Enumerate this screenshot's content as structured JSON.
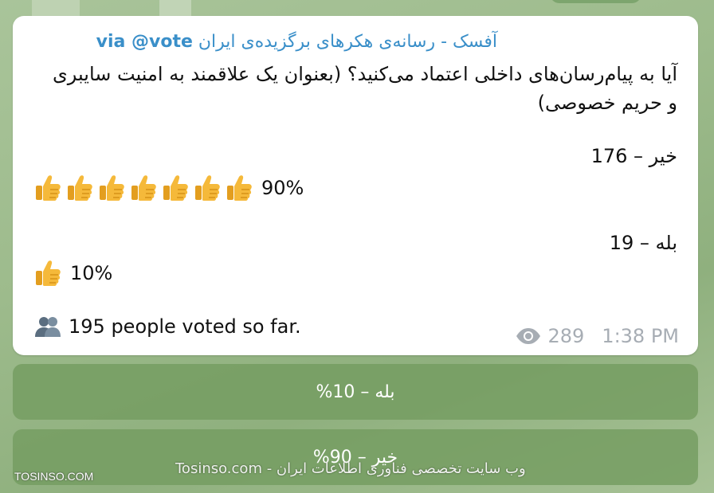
{
  "message": {
    "via_channel": "آفسک - رسانه‌ی هکرهای برگزیده‌ی ایران",
    "via_label": "via @vote",
    "question": "آیا به پیام‌رسان‌های داخلی اعتماد می‌کنید؟ (بعنوان یک علاقمند به امنیت سایبری و حریم خصوصی)",
    "options": [
      {
        "label": "خیر – 176",
        "percent_text": "90%",
        "percent": 90,
        "thumbs": 7
      },
      {
        "label": "بله – 19",
        "percent_text": "10%",
        "percent": 10,
        "thumbs": 1
      }
    ],
    "voters_text": "195 people voted so far.",
    "views": "289",
    "time": "1:38 PM"
  },
  "buttons": [
    {
      "label": "بله – 10%"
    },
    {
      "label": "خیر – 90%"
    }
  ],
  "watermark": {
    "left": "TOSINSO.COM",
    "center": "Tosinso.com - وب سایت تخصصی فناوری اطلاعات ایران"
  },
  "colors": {
    "link": "#3a8fc9",
    "thumb": "#f2b231",
    "button_bg": "#749c60",
    "meta": "#a7adb4"
  },
  "icons": {
    "thumb": "thumbs-up-icon",
    "voters": "people-icon",
    "views": "eye-icon"
  }
}
